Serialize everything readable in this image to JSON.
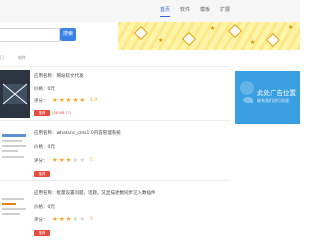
{
  "nav": {
    "items": [
      {
        "label": "首页",
        "active": true
      },
      {
        "label": "软件",
        "active": false
      },
      {
        "label": "模板",
        "active": false
      },
      {
        "label": "扩展",
        "active": false
      }
    ]
  },
  "search": {
    "button_label": "搜索",
    "placeholder": ""
  },
  "tabs": [
    "门",
    "软件"
  ],
  "apps": [
    {
      "name_line": "应用名称：网站软文代发",
      "price_line": "价格：0元",
      "rating_label": "评分：",
      "rating": 4.5,
      "score_text": "4.9",
      "download_label": "推荐",
      "size_text": "(48 MB 17)"
    },
    {
      "name_line": "应用名称：whatsns_cms1.0内容管理系统",
      "price_line": "价格：0元",
      "rating_label": "评分：",
      "rating": 3,
      "score_text": "5",
      "download_label": "推荐",
      "size_text": ""
    },
    {
      "name_line": "应用名称：批量设置问题，话题，又显描述数同步汪入数插件",
      "price_line": "价格：0元",
      "rating_label": "评分：",
      "rating": 3,
      "score_text": "5",
      "download_label": "推荐",
      "size_text": ""
    }
  ],
  "ad": {
    "title": "此处广告位置",
    "subtitle": "联系我们进行投放",
    "color": "#3a9fe0"
  },
  "colors": {
    "accent": "#2f6bd6",
    "star": "#f5a623",
    "download": "#e74c3c"
  }
}
